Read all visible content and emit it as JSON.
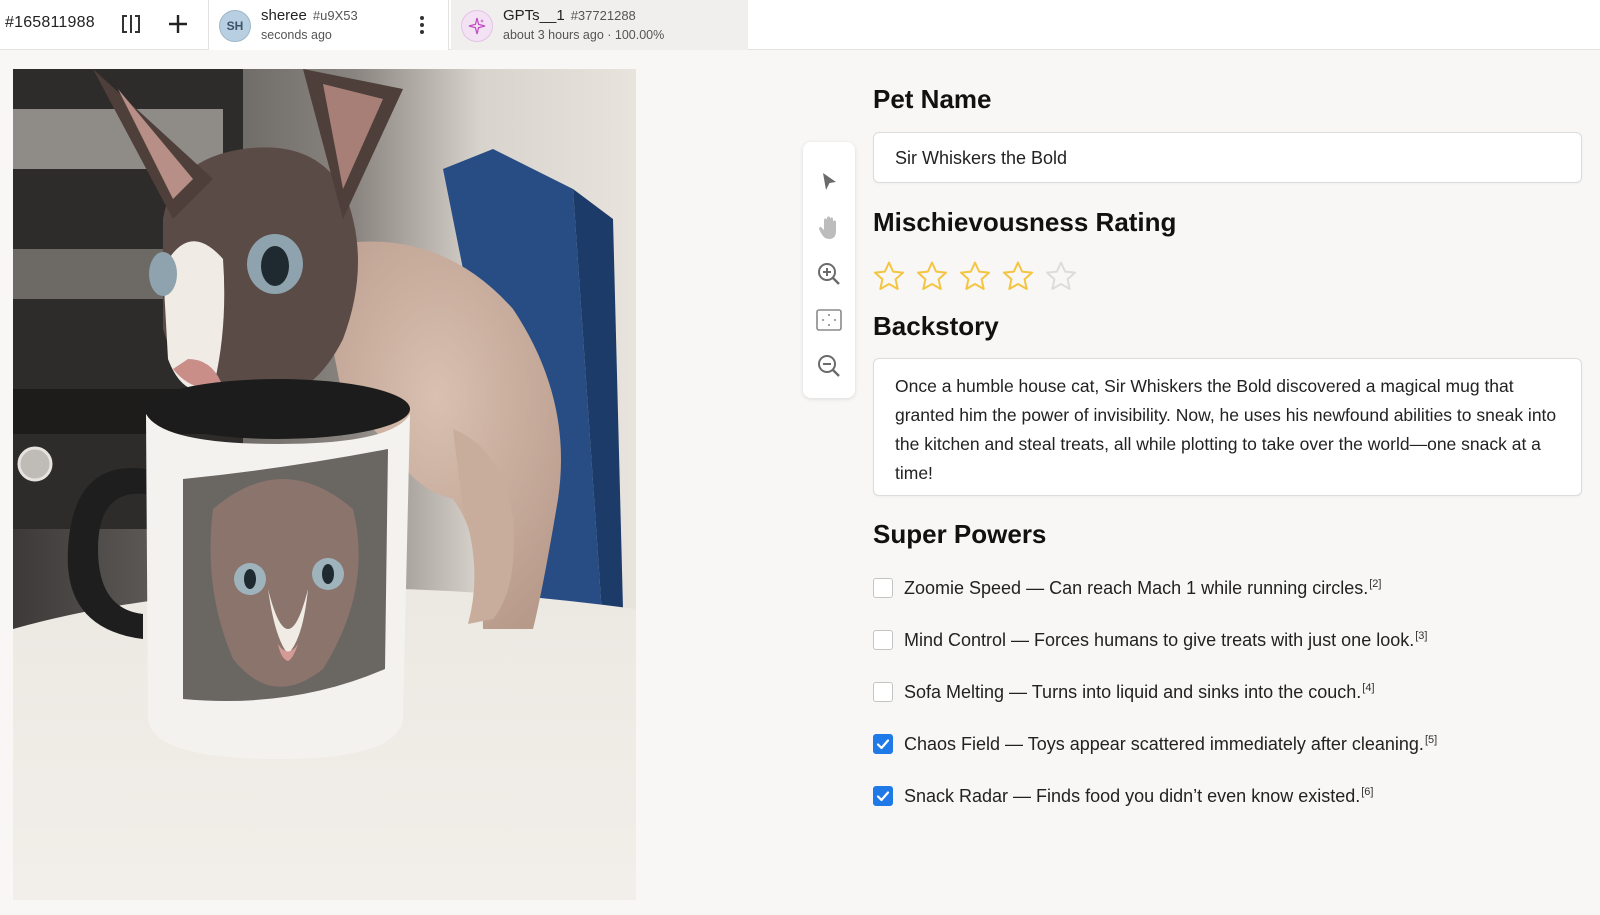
{
  "header": {
    "task_id": "#165811988",
    "tabs": [
      {
        "avatar": "SH",
        "name": "sheree",
        "hash": "#u9X53",
        "sub": "seconds ago",
        "active": true
      },
      {
        "avatar": "",
        "name": "GPTs__1",
        "hash": "#37721288",
        "sub": "about 3 hours ago · 100.00%",
        "active": false
      }
    ]
  },
  "toolbar": {
    "tools": [
      "pointer-icon",
      "hand-icon",
      "zoom-in-icon",
      "fit-screen-icon",
      "zoom-out-icon"
    ]
  },
  "form": {
    "pet_name_label": "Pet Name",
    "pet_name_value": "Sir Whiskers the Bold",
    "rating_label": "Mischievousness Rating",
    "rating": {
      "value": 4,
      "max": 5,
      "filled_color": "#f4c542",
      "empty_color": "#dcdcdc"
    },
    "backstory_label": "Backstory",
    "backstory_text": "Once a humble house cat, Sir Whiskers the Bold discovered a magical mug that granted him the power of invisibility. Now, he uses his newfound abilities to sneak into the kitchen and steal treats, all while plotting to take over the world—one snack at a time!",
    "powers_label": "Super Powers",
    "powers": [
      {
        "text": "Zoomie Speed — Can reach Mach 1 while running circles.",
        "ref": "[2]",
        "checked": false
      },
      {
        "text": "Mind Control — Forces humans to give treats with just one look.",
        "ref": "[3]",
        "checked": false
      },
      {
        "text": "Sofa Melting — Turns into liquid and sinks into the couch.",
        "ref": "[4]",
        "checked": false
      },
      {
        "text": "Chaos Field — Toys appear scattered immediately after cleaning.",
        "ref": "[5]",
        "checked": true
      },
      {
        "text": "Snack Radar — Finds food you didn’t even know existed.",
        "ref": "[6]",
        "checked": true
      }
    ]
  },
  "colors": {
    "accent": "#1f7ae8",
    "star": "#f4c542"
  }
}
